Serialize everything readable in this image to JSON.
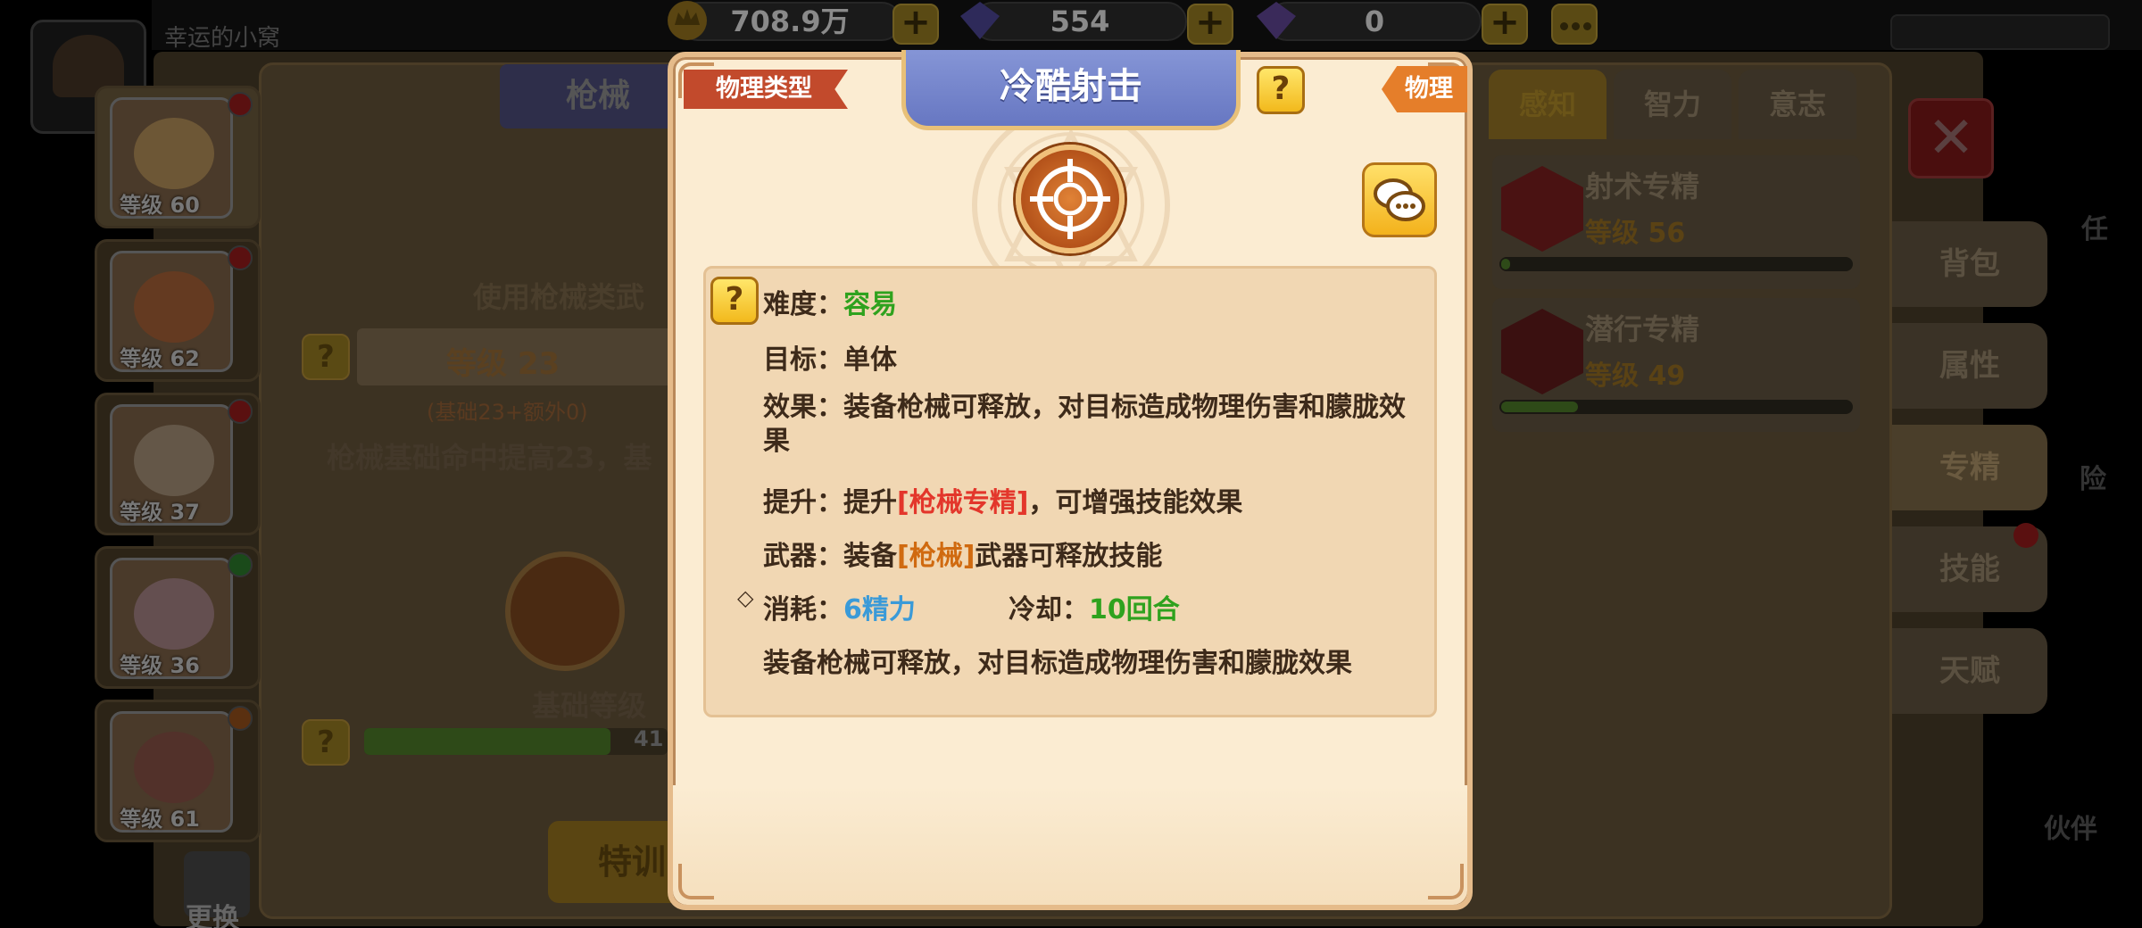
{
  "topbar": {
    "home_title": "幸运的小窝",
    "gold": "708.9万",
    "diamond": "554",
    "gem": "0",
    "plus": "+"
  },
  "characters": [
    {
      "level": "等级 60"
    },
    {
      "level": "等级 62"
    },
    {
      "level": "等级 37"
    },
    {
      "level": "等级 36"
    },
    {
      "level": "等级 61"
    }
  ],
  "left_panel": {
    "title": "枪械",
    "desc": "使用枪械类武",
    "level": "等级 23",
    "level_sub": "(基础23+额外0)",
    "effect_line": "枪械基础命中提高23，基",
    "base_level": "基础等级",
    "bar_value": "41",
    "bar_fill": 0.81,
    "train_btn": "特训",
    "swap_label": "更换",
    "q": "?"
  },
  "right_panel": {
    "tabs": [
      "感知",
      "智力",
      "意志"
    ],
    "specs": [
      {
        "name": "射术专精",
        "level": "等级 56",
        "progress": 0.02
      },
      {
        "name": "潜行专精",
        "level": "等级 49",
        "progress": 0.14
      }
    ],
    "side_tabs": [
      "背包",
      "属性",
      "专精",
      "技能",
      "天赋"
    ],
    "close": "✕",
    "far_right": [
      "任",
      "险",
      "伙伴"
    ]
  },
  "modal": {
    "type_label": "物理类型",
    "title": "冷酷射击",
    "damage_type": "物理",
    "q": "?",
    "difficulty_label": "难度：",
    "difficulty_value": "容易",
    "target_label": "目标：",
    "target_value": "单体",
    "effect_label": "效果：",
    "effect_value": "装备枪械可释放，对目标造成物理伤害和朦胧效果",
    "upgrade_label": "提升：",
    "upgrade_prefix": "提升",
    "upgrade_link": "[枪械专精]",
    "upgrade_suffix": "，可增强技能效果",
    "weapon_label": "武器：",
    "weapon_prefix": "装备",
    "weapon_link": "[枪械]",
    "weapon_suffix": "武器可释放技能",
    "cost_label": "消耗：",
    "cost_value": "6精力",
    "cooldown_label": "冷却：",
    "cooldown_value": "10回合",
    "summary": "装备枪械可释放，对目标造成物理伤害和朦胧效果"
  },
  "colors": {
    "easy_green": "#2fa21e",
    "cost_blue": "#3a9ad8",
    "link_red": "#e3362b",
    "link_orange": "#d06a10",
    "banner_blue": "#7585cc"
  }
}
